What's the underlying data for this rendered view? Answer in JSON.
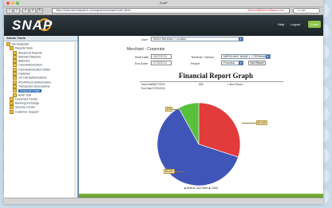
{
  "window": {
    "title": "SnAP"
  },
  "toolbar": {
    "url": "https://www.sterndapatent.com/sap/stm/fastmain/index.htmlx",
    "url_right": "sternsoft@sternsoftware.com",
    "search_placeholder": "Google"
  },
  "header": {
    "logo": "SNAP",
    "help": "Help",
    "logout": "Logout",
    "button": "Close"
  },
  "sidebar": {
    "title": "Admin Tools",
    "items": [
      {
        "label": "My Snapstart"
      },
      {
        "label": "Reports Tools"
      },
      {
        "label": "Advanced Reports"
      },
      {
        "label": "Standard Reports"
      },
      {
        "label": "Batteries"
      },
      {
        "label": "Card Authorization"
      },
      {
        "label": "Card Authorization Totals"
      },
      {
        "label": "Captures"
      },
      {
        "label": "On Call Authorizations"
      },
      {
        "label": "ACH/Phone Authorization"
      },
      {
        "label": "Transaction Descriptions"
      },
      {
        "label": "Financial Graph"
      },
      {
        "label": "Audit Trail"
      },
      {
        "label": "Document Center"
      },
      {
        "label": "Banking Exchange"
      },
      {
        "label": "Security Center"
      },
      {
        "label": "Customer Support"
      }
    ]
  },
  "main": {
    "user_label": "User",
    "user_value": "Select Merchant / Location",
    "subheading": "Merchant - Corporate",
    "start_label": "Start Date",
    "start_value": "06/27/2013",
    "end_label": "End Date",
    "end_value": "07/25/2013",
    "terminal_label": "Terminal / Device",
    "terminal_value": "MERCHANT NAME 1 / TERMINAL",
    "report_label": "Report",
    "report_value": "Financial",
    "get_report": "Get Report",
    "report_title": "Financial Report Graph",
    "meta_start_label": "Start Date",
    "meta_start_value": "06/27/2013",
    "meta_end_label": "End Date",
    "meta_end_value": "07/25/2013",
    "meta_mid_label": "MID",
    "meta_right": "1 Item Shown",
    "legend": "■ Debit ■ Card Sales ■ Credit"
  },
  "chart_data": {
    "type": "pie",
    "values": [
      62,
      30,
      8
    ],
    "colors": [
      "#3f55b8",
      "#e23b3b",
      "#58c03c"
    ],
    "labels": [
      "$1,041",
      "$1,048",
      "$78"
    ]
  }
}
